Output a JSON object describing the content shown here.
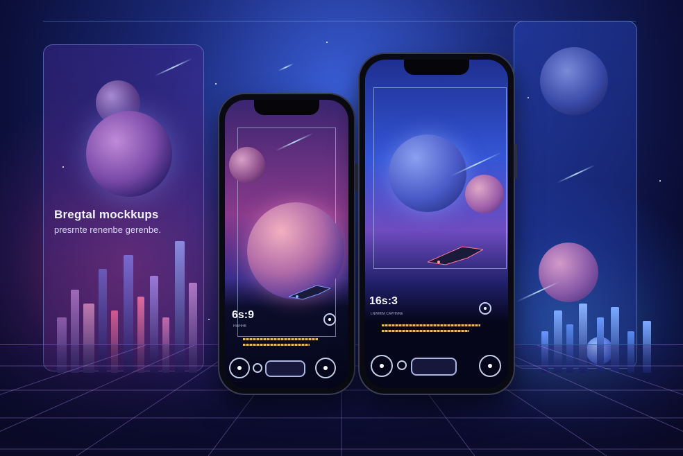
{
  "headline": {
    "title": "Bregtal mockkups",
    "subtitle": "presrnte renenbe gerenbe."
  },
  "phone_left": {
    "readout": "6s:9",
    "caption": "HWHHB"
  },
  "phone_right": {
    "readout": "16s:3",
    "caption": "LNWMIM  CAPHNNE"
  },
  "colors": {
    "accent_pink": "#e2468c",
    "accent_blue": "#3a6dff",
    "background": "#0b0f3a"
  }
}
